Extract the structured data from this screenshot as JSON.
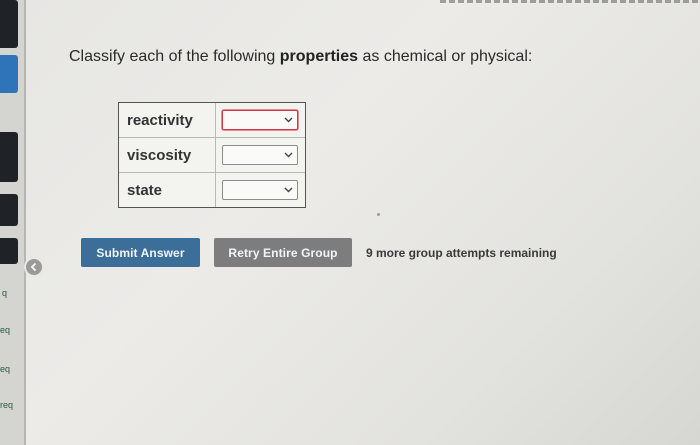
{
  "prompt": {
    "prefix": "Classify each of the following ",
    "bold": "properties",
    "suffix": " as chemical or physical:"
  },
  "properties": [
    {
      "label": "reactivity",
      "selected": "",
      "invalid": true
    },
    {
      "label": "viscosity",
      "selected": "",
      "invalid": false
    },
    {
      "label": "state",
      "selected": "",
      "invalid": false
    }
  ],
  "buttons": {
    "submit": "Submit Answer",
    "retry": "Retry Entire Group"
  },
  "attempts_text": "9 more group attempts remaining",
  "sidebar": {
    "labels": [
      "q",
      "eq",
      "eq",
      "req"
    ]
  },
  "colors": {
    "submit_bg": "#3b6e98",
    "retry_bg": "#7d7d7d",
    "invalid_border": "#d23a4a",
    "sidebar_tab_dark": "#1f2328",
    "sidebar_tab_blue": "#2f74b8"
  },
  "icons": {
    "collapse": "chevron-left-icon",
    "dropdown": "chevron-down-icon"
  }
}
